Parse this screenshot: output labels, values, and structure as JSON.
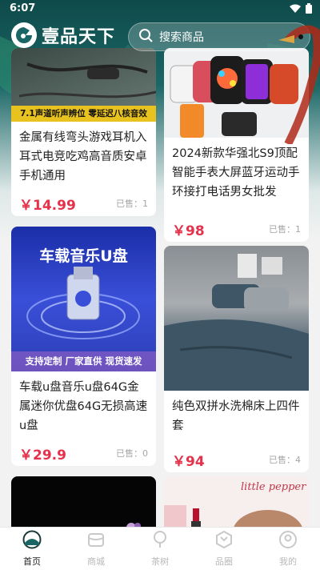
{
  "status": {
    "time": "6:07"
  },
  "header": {
    "app_name": "壹品天下",
    "search_placeholder": "搜索商品"
  },
  "products": [
    {
      "title": "金属有线弯头游戏耳机入耳式电竞吃鸡高音质安卓手机通用",
      "price": "￥14.99",
      "sold": "已售：1",
      "banner_text": "7.1声道听声辨位 零延迟八核音效"
    },
    {
      "title": "2024新款华强北S9顶配智能手表大屏蓝牙运动手环接打电话男女批发",
      "price": "￥98",
      "sold": "已售：1"
    },
    {
      "title": "车载u盘音乐u盘64G金属迷你优盘64G无损高速u盘",
      "price": "￥29.9",
      "sold": "已售：0",
      "banner_big": "车载音乐U盘",
      "banner_bottom": "支持定制  厂家直供  现货速发"
    },
    {
      "title": "纯色双拼水洗棉床上四件套",
      "price": "￥94",
      "sold": "已售：4"
    },
    {
      "title": "",
      "price": "",
      "sold": ""
    },
    {
      "title": "",
      "price": "",
      "sold": "",
      "banner_text": "little pepper"
    }
  ],
  "tabs": [
    {
      "label": "首页",
      "icon": "home-icon",
      "active": true
    },
    {
      "label": "商城",
      "icon": "shop-icon",
      "active": false
    },
    {
      "label": "茶树",
      "icon": "tree-icon",
      "active": false
    },
    {
      "label": "品圈",
      "icon": "circle-icon",
      "active": false
    },
    {
      "label": "我的",
      "icon": "profile-icon",
      "active": false
    }
  ],
  "colors": {
    "accent": "#e5314b",
    "header": "#1a6666"
  }
}
